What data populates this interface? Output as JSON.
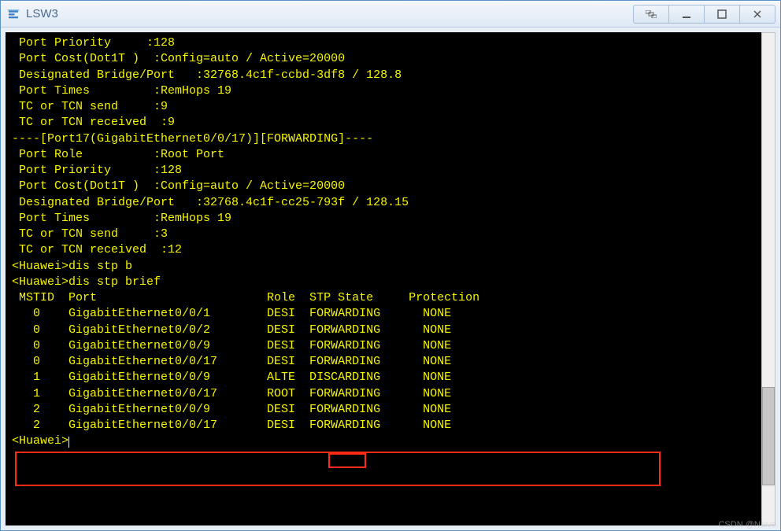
{
  "window": {
    "title": "LSW3"
  },
  "terminal": {
    "lines": [
      " Port Priority     :128",
      " Port Cost(Dot1T )  :Config=auto / Active=20000",
      " Designated Bridge/Port   :32768.4c1f-ccbd-3df8 / 128.8",
      " Port Times         :RemHops 19",
      " TC or TCN send     :9",
      " TC or TCN received  :9",
      "----[Port17(GigabitEthernet0/0/17)][FORWARDING]----",
      " Port Role          :Root Port",
      " Port Priority      :128",
      " Port Cost(Dot1T )  :Config=auto / Active=20000",
      " Designated Bridge/Port   :32768.4c1f-cc25-793f / 128.15",
      " Port Times         :RemHops 19",
      " TC or TCN send     :3",
      " TC or TCN received  :12",
      "<Huawei>dis stp b",
      "<Huawei>dis stp brief"
    ],
    "table_header": " MSTID  Port                        Role  STP State     Protection",
    "rows": [
      {
        "mstid": "0",
        "port": "GigabitEthernet0/0/1",
        "role": "DESI",
        "state": "FORWARDING",
        "prot": "NONE"
      },
      {
        "mstid": "0",
        "port": "GigabitEthernet0/0/2",
        "role": "DESI",
        "state": "FORWARDING",
        "prot": "NONE"
      },
      {
        "mstid": "0",
        "port": "GigabitEthernet0/0/9",
        "role": "DESI",
        "state": "FORWARDING",
        "prot": "NONE"
      },
      {
        "mstid": "0",
        "port": "GigabitEthernet0/0/17",
        "role": "DESI",
        "state": "FORWARDING",
        "prot": "NONE"
      },
      {
        "mstid": "1",
        "port": "GigabitEthernet0/0/9",
        "role": "ALTE",
        "state": "DISCARDING",
        "prot": "NONE"
      },
      {
        "mstid": "1",
        "port": "GigabitEthernet0/0/17",
        "role": "ROOT",
        "state": "FORWARDING",
        "prot": "NONE"
      },
      {
        "mstid": "2",
        "port": "GigabitEthernet0/0/9",
        "role": "DESI",
        "state": "FORWARDING",
        "prot": "NONE"
      },
      {
        "mstid": "2",
        "port": "GigabitEthernet0/0/17",
        "role": "DESI",
        "state": "FORWARDING",
        "prot": "NONE"
      }
    ],
    "prompt": "<Huawei>"
  },
  "watermark": "CSDN @Naive"
}
